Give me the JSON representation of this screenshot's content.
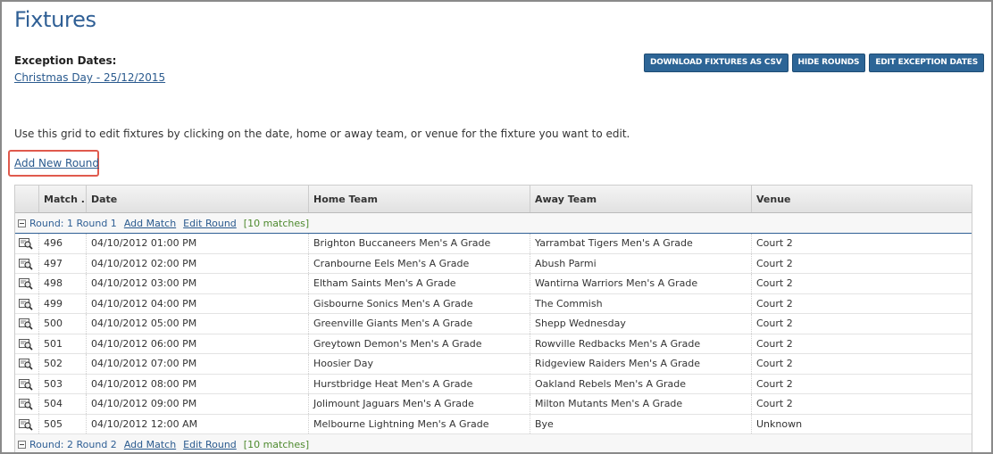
{
  "page": {
    "title": "Fixtures",
    "exception_label": "Exception Dates:",
    "exception_link": "Christmas Day - 25/12/2015",
    "instructions": "Use this grid to edit fixtures by clicking on the date, home or away team, or venue for the fixture you want to edit.",
    "add_round_label": "Add New Round"
  },
  "toolbar": {
    "download_csv": "DOWNLOAD FIXTURES AS CSV",
    "hide_rounds": "HIDE ROUNDS",
    "edit_exception_dates": "EDIT EXCEPTION DATES"
  },
  "grid": {
    "columns": [
      "",
      "Match ...",
      "Date",
      "Home Team",
      "Away Team",
      "Venue"
    ],
    "rounds": [
      {
        "label": "Round: 1 Round 1",
        "add_match": "Add Match",
        "edit_round": "Edit Round",
        "count": "[10 matches]",
        "matches": [
          {
            "id": "496",
            "date": "04/10/2012 01:00 PM",
            "home": "Brighton Buccaneers Men's A Grade",
            "away": "Yarrambat Tigers Men's A Grade",
            "venue": "Court 2"
          },
          {
            "id": "497",
            "date": "04/10/2012 02:00 PM",
            "home": "Cranbourne Eels Men's A Grade",
            "away": "Abush Parmi",
            "venue": "Court 2"
          },
          {
            "id": "498",
            "date": "04/10/2012 03:00 PM",
            "home": "Eltham Saints Men's A Grade",
            "away": "Wantirna Warriors Men's A Grade",
            "venue": "Court 2"
          },
          {
            "id": "499",
            "date": "04/10/2012 04:00 PM",
            "home": "Gisbourne Sonics Men's A Grade",
            "away": "The Commish",
            "venue": "Court 2"
          },
          {
            "id": "500",
            "date": "04/10/2012 05:00 PM",
            "home": "Greenville Giants Men's A Grade",
            "away": "Shepp Wednesday",
            "venue": "Court 2"
          },
          {
            "id": "501",
            "date": "04/10/2012 06:00 PM",
            "home": "Greytown Demon's Men's A Grade",
            "away": "Rowville Redbacks Men's A Grade",
            "venue": "Court 2"
          },
          {
            "id": "502",
            "date": "04/10/2012 07:00 PM",
            "home": "Hoosier Day",
            "away": "Ridgeview Raiders Men's A Grade",
            "venue": "Court 2"
          },
          {
            "id": "503",
            "date": "04/10/2012 08:00 PM",
            "home": "Hurstbridge Heat Men's A Grade",
            "away": "Oakland Rebels Men's A Grade",
            "venue": "Court 2"
          },
          {
            "id": "504",
            "date": "04/10/2012 09:00 PM",
            "home": "Jolimount Jaguars Men's A Grade",
            "away": "Milton Mutants Men's A Grade",
            "venue": "Court 2"
          },
          {
            "id": "505",
            "date": "04/10/2012 12:00 AM",
            "home": "Melbourne Lightning Men's A Grade",
            "away": "Bye",
            "venue": "Unknown"
          }
        ]
      },
      {
        "label": "Round: 2 Round 2",
        "add_match": "Add Match",
        "edit_round": "Edit Round",
        "count": "[10 matches]",
        "matches": []
      }
    ]
  },
  "colors": {
    "title": "#2f5f95",
    "button": "#2d6596",
    "link": "#2a5a8e",
    "highlight_box": "#e05a4d",
    "match_count": "#4e8a2e"
  },
  "icons": {
    "row_view": "view-details-icon",
    "group_toggle": "collapse-icon"
  }
}
